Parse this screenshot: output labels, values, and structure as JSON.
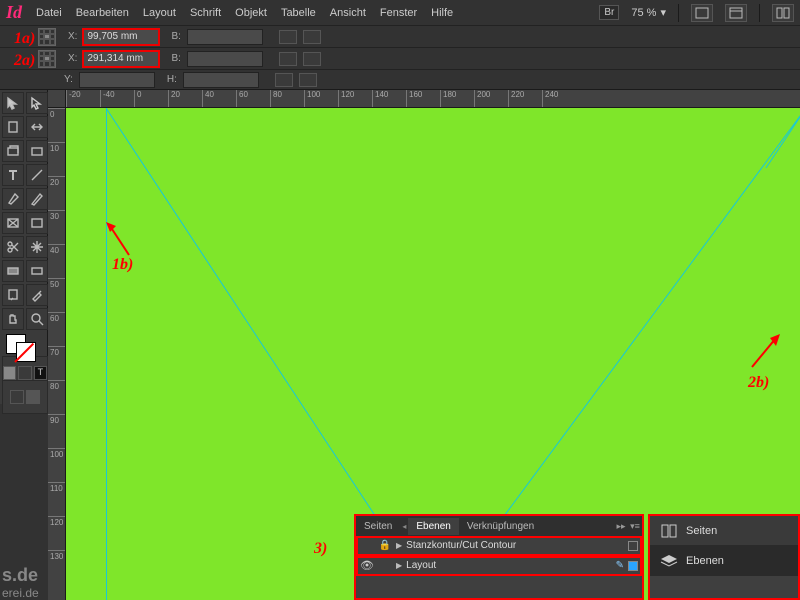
{
  "app": {
    "logo": "Id"
  },
  "menu": {
    "items": [
      "Datei",
      "Bearbeiten",
      "Layout",
      "Schrift",
      "Objekt",
      "Tabelle",
      "Ansicht",
      "Fenster",
      "Hilfe"
    ],
    "bridge": "Br",
    "zoom": "75 %"
  },
  "ctrl1": {
    "x_label": "X:",
    "x_value": "99,705 mm",
    "b_label": "B:",
    "b_value": ""
  },
  "ctrl2": {
    "x_label": "X:",
    "x_value": "291,314 mm",
    "b_label": "B:",
    "b_value": "",
    "y_label": "Y:",
    "y_value": "",
    "h_label": "H:",
    "h_value": ""
  },
  "ruler_h": [
    "-20",
    "-40",
    "0",
    "20",
    "40",
    "60",
    "80",
    "100",
    "120",
    "140",
    "160",
    "180",
    "200",
    "220",
    "240"
  ],
  "ruler_v": [
    "0",
    "10",
    "20",
    "30",
    "40",
    "50",
    "60",
    "70",
    "80",
    "90",
    "100",
    "110",
    "120",
    "130"
  ],
  "annotations": {
    "a1": "1a)",
    "a2": "2a)",
    "b1": "1b)",
    "b2": "2b)",
    "c3": "3)"
  },
  "layers_panel": {
    "tabs": [
      "Seiten",
      "Ebenen",
      "Verknüpfungen"
    ],
    "active_tab": 1,
    "rows": [
      {
        "name": "Stanzkontur/Cut Contour",
        "locked": true,
        "visible": false
      },
      {
        "name": "Layout",
        "locked": false,
        "visible": true
      }
    ]
  },
  "side_panel": {
    "items": [
      {
        "label": "Seiten",
        "active": false
      },
      {
        "label": "Ebenen",
        "active": true
      }
    ]
  },
  "watermark": {
    "l1": "s.de",
    "l2": "erei.de"
  }
}
